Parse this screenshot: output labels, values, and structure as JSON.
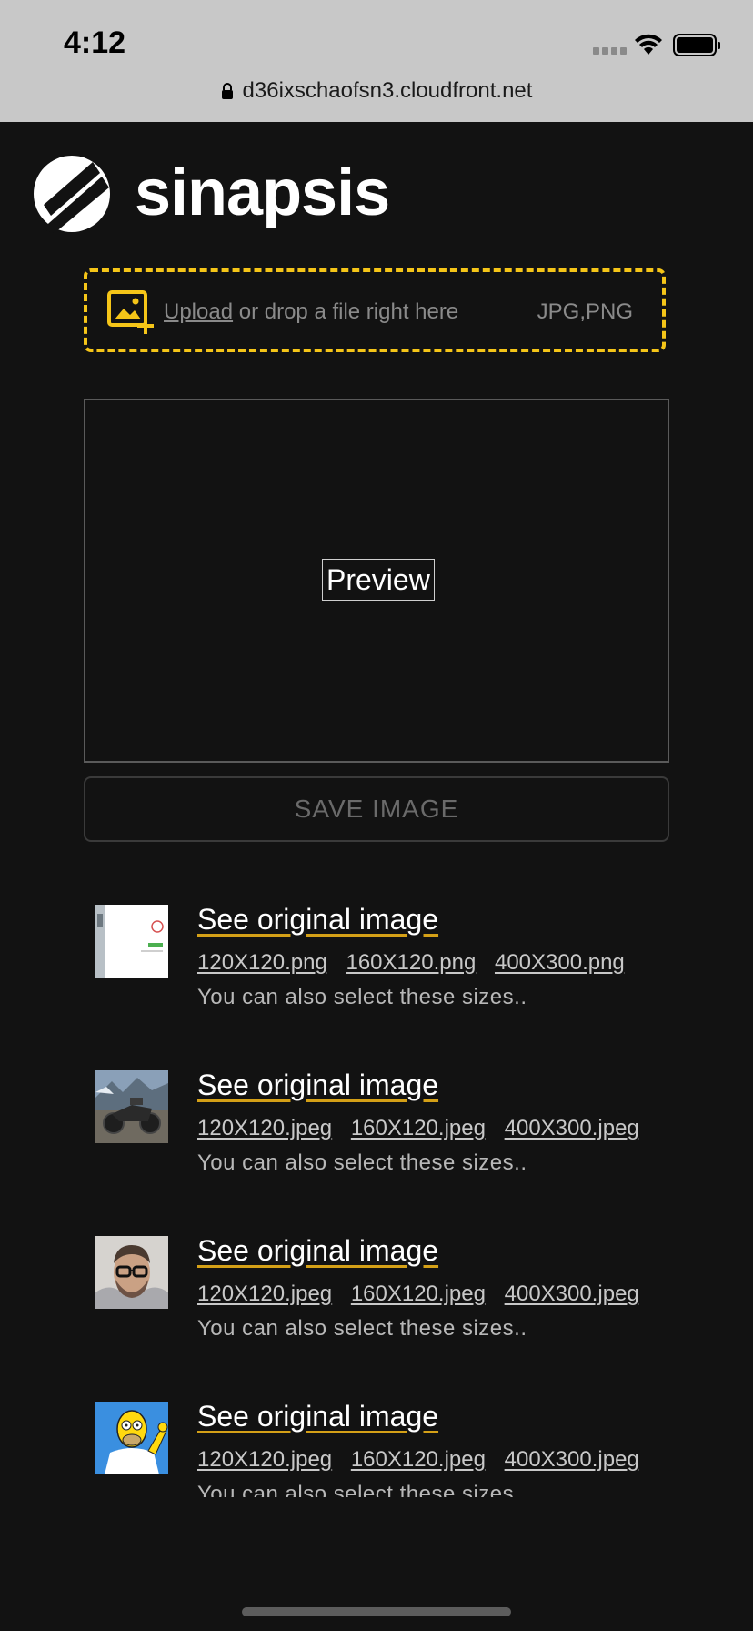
{
  "status_bar": {
    "time": "4:12",
    "url": "d36ixschaofsn3.cloudfront.net"
  },
  "logo": {
    "text": "sinapsis"
  },
  "upload": {
    "link_label": "Upload",
    "text": " or drop a file right here",
    "accepted_types": "JPG,PNG"
  },
  "preview": {
    "label": "Preview"
  },
  "save_button": {
    "label": "SAVE IMAGE"
  },
  "images": [
    {
      "thumb": "screenshot-thumbnail",
      "link": "See original image",
      "sizes": [
        "120X120.png",
        "160X120.png",
        "400X300.png"
      ],
      "hint": "You can also select these sizes.."
    },
    {
      "thumb": "motorcycle-photo",
      "link": "See original image",
      "sizes": [
        "120X120.jpeg",
        "160X120.jpeg",
        "400X300.jpeg"
      ],
      "hint": "You can also select these sizes.."
    },
    {
      "thumb": "man-with-glasses-photo",
      "link": "See original image",
      "sizes": [
        "120X120.jpeg",
        "160X120.jpeg",
        "400X300.jpeg"
      ],
      "hint": "You can also select these sizes.."
    },
    {
      "thumb": "homer-simpson-cartoon",
      "link": "See original image",
      "sizes": [
        "120X120.jpeg",
        "160X120.jpeg",
        "400X300.jpeg"
      ],
      "hint": "You can also select these sizes.."
    }
  ],
  "colors": {
    "background": "#121212",
    "accent": "#f5c518",
    "status_bar": "#c8c8c8"
  }
}
